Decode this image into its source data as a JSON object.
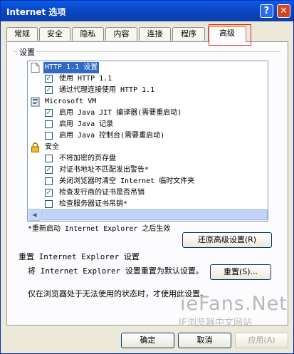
{
  "window": {
    "title": "Internet 选项",
    "help_glyph": "?",
    "close_glyph": "✕"
  },
  "tabs": [
    {
      "label": "常规"
    },
    {
      "label": "安全"
    },
    {
      "label": "隐私"
    },
    {
      "label": "内容"
    },
    {
      "label": "连接"
    },
    {
      "label": "程序"
    },
    {
      "label": "高级",
      "active": true
    }
  ],
  "settings": {
    "group_label": "设置",
    "items": [
      {
        "type": "header",
        "icon": "page-icon",
        "label": "HTTP 1.1 设置",
        "selected": true
      },
      {
        "type": "checkbox",
        "checked": true,
        "label": "使用 HTTP 1.1"
      },
      {
        "type": "checkbox",
        "checked": true,
        "label": "通过代理连接使用 HTTP 1.1"
      },
      {
        "type": "header",
        "icon": "java-vm-icon",
        "label": "Microsoft VM"
      },
      {
        "type": "checkbox",
        "checked": true,
        "label": "启用 Java JIT 编译器(需要重启动)"
      },
      {
        "type": "checkbox",
        "checked": false,
        "label": "启用 Java 记录"
      },
      {
        "type": "checkbox",
        "checked": false,
        "label": "启用 Java 控制台(需要重启动)"
      },
      {
        "type": "header",
        "icon": "lock-icon",
        "label": "安全"
      },
      {
        "type": "checkbox",
        "checked": false,
        "label": "不将加密的页存盘"
      },
      {
        "type": "checkbox",
        "checked": true,
        "label": "对证书地址不匹配发出警告*"
      },
      {
        "type": "checkbox",
        "checked": false,
        "label": "关闭浏览器时清空 Internet 临时文件夹"
      },
      {
        "type": "checkbox",
        "checked": true,
        "label": "检查发行商的证书是否吊销"
      },
      {
        "type": "checkbox",
        "checked": false,
        "label": "检查服务器证书吊销*"
      }
    ],
    "restart_note": "*重新启动 Internet Explorer 之后生效",
    "restore_button": "还原高级设置(R)"
  },
  "reset": {
    "heading": "重置 Internet Explorer 设置",
    "description": "将 Internet Explorer 设置重置为默认设置。",
    "reset_button": "重置(S)...",
    "note": "仅在浏览器处于无法使用的状态时，才使用此设置。"
  },
  "watermark": {
    "line1": "ieFans.Net",
    "line2": "IE浏览器中文网站"
  },
  "footer": {
    "ok": "确定",
    "cancel": "取消",
    "apply": "应用(A)"
  },
  "colors": {
    "title_bar": "#0a49c9",
    "checkmark": "#21a121",
    "highlight_box": "#e21f1f",
    "selection": "#316ac5"
  }
}
